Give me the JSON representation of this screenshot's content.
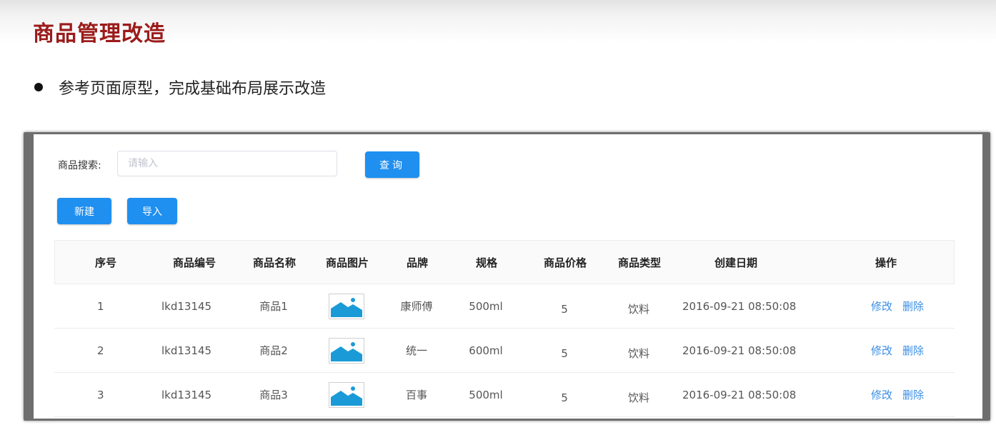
{
  "slide": {
    "title": "商品管理改造",
    "bullet": "参考页面原型，完成基础布局展示改造"
  },
  "search": {
    "label": "商品搜索:",
    "placeholder": "请输入",
    "value": "",
    "query_button": "查询"
  },
  "toolbar": {
    "new_button": "新建",
    "import_button": "导入"
  },
  "table": {
    "columns": [
      "序号",
      "商品编号",
      "商品名称",
      "商品图片",
      "品牌",
      "规格",
      "商品价格",
      "商品类型",
      "创建日期",
      "操作"
    ],
    "rows": [
      {
        "index": "1",
        "code": "lkd13145",
        "name": "商品1",
        "image_icon": "image-placeholder-icon",
        "brand": "康师傅",
        "spec": "500ml",
        "price": "5",
        "type": "饮料",
        "created": "2016-09-21  08:50:08",
        "edit": "修改",
        "delete": "删除"
      },
      {
        "index": "2",
        "code": "lkd13145",
        "name": "商品2",
        "image_icon": "image-placeholder-icon",
        "brand": "统一",
        "spec": "600ml",
        "price": "5",
        "type": "饮料",
        "created": "2016-09-21  08:50:08",
        "edit": "修改",
        "delete": "删除"
      },
      {
        "index": "3",
        "code": "lkd13145",
        "name": "商品3",
        "image_icon": "image-placeholder-icon",
        "brand": "百事",
        "spec": "500ml",
        "price": "5",
        "type": "饮料",
        "created": "2016-09-21  08:50:08",
        "edit": "修改",
        "delete": "删除"
      }
    ]
  },
  "colors": {
    "title": "#9b1b1b",
    "primary_button": "#1f8ff0",
    "link": "#3a8ee6",
    "image_icon": "#1a9bd7"
  }
}
